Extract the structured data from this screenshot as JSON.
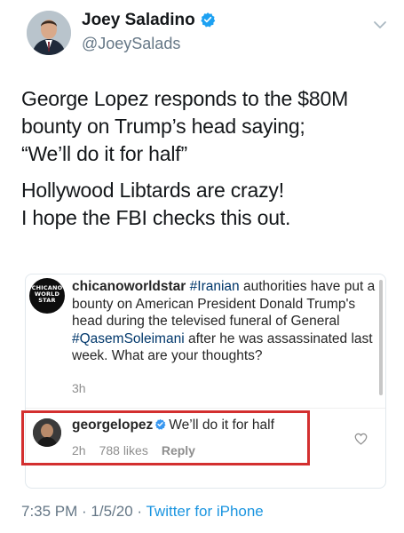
{
  "tweet": {
    "author": {
      "display_name": "Joey Saladino",
      "handle": "@JoeySalads"
    },
    "paragraphs": [
      [
        "George Lopez responds to the $80M",
        "bounty on Trump’s head saying;",
        "“We’ll do it for half”"
      ],
      [
        "Hollywood Libtards are crazy!",
        "I hope the FBI checks this out."
      ]
    ],
    "timestamp": "7:35 PM · 1/5/20 · ",
    "source": "Twitter for iPhone"
  },
  "embedded_post": {
    "avatar_text": "CHICANO WORLD STAR",
    "comment": {
      "username": "chicanoworldstar",
      "segments": [
        {
          "text": " ",
          "type": "plain"
        },
        {
          "text": "#Iranian",
          "type": "hashtag"
        },
        {
          "text": " authorities have put a bounty on American President Donald Trump's head during the televised funeral of General ",
          "type": "plain"
        },
        {
          "text": "#QasemSoleimani",
          "type": "hashtag"
        },
        {
          "text": " after he was assassinated last week. What are your thoughts?",
          "type": "plain"
        }
      ],
      "time": "3h"
    },
    "reply": {
      "username": "georgelopez",
      "text": "We’ll do it for half",
      "time": "2h",
      "likes": "788 likes",
      "reply_label": "Reply"
    }
  },
  "colors": {
    "link_blue": "#1b95e0",
    "verified_blue": "#1da1f2",
    "highlight_red": "#d32f2f",
    "hashtag_blue": "#00376b"
  },
  "icons": [
    "verified-badge-icon",
    "chevron-down-icon",
    "heart-icon",
    "instagram-verified-icon"
  ]
}
